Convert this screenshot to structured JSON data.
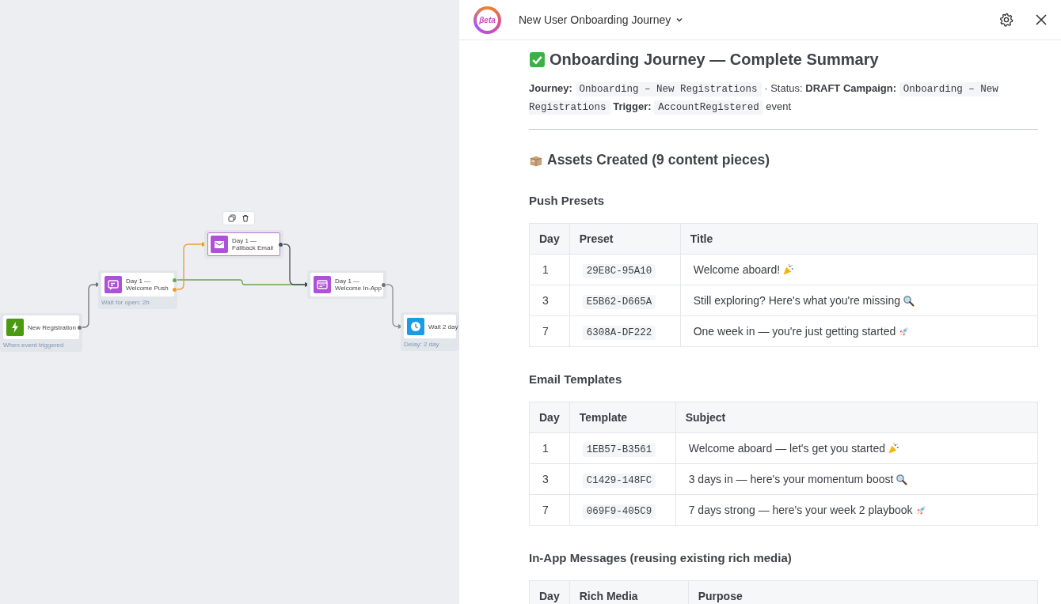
{
  "canvas": {
    "nodes": [
      {
        "kind": "trigger",
        "title": "New Registration",
        "subtitle": "When event triggered",
        "selected": false
      },
      {
        "kind": "push",
        "title": "Day 1 —\nWelcome Push",
        "subtitle": "Wait for open: 2h",
        "selected": false
      },
      {
        "kind": "email",
        "title": "Day 1 —\nFallback Email",
        "selected": true
      },
      {
        "kind": "inapp",
        "title": "Day 1 —\nWelcome In-App",
        "selected": false
      },
      {
        "kind": "delay",
        "title": "Wait 2 day",
        "subtitle": "Delay: 2 day",
        "selected": false
      }
    ]
  },
  "header": {
    "logo_text": "βeta",
    "title": "New User Onboarding Journey"
  },
  "summary": {
    "title": "Onboarding Journey — Complete Summary",
    "meta": [
      {
        "kind": "label",
        "text": "Journey:"
      },
      {
        "kind": "code",
        "text": "Onboarding – New Registrations"
      },
      {
        "kind": "text",
        "text": "· Status:"
      },
      {
        "kind": "label",
        "text": "DRAFT Campaign:"
      },
      {
        "kind": "code",
        "text": "Onboarding – New Registrations"
      },
      {
        "kind": "label",
        "text": "Trigger:"
      },
      {
        "kind": "code",
        "text": "AccountRegistered"
      },
      {
        "kind": "text",
        "text": "event"
      }
    ],
    "assets_title": "Assets Created (9 content pieces)",
    "sections": [
      {
        "title": "Push Presets",
        "columns": [
          "Day",
          "Preset",
          "Title"
        ],
        "rows": [
          {
            "day": "1",
            "id": "29E8C-95A10",
            "text": "Welcome aboard!",
            "kind": "party"
          },
          {
            "day": "3",
            "id": "E5B62-D665A",
            "text": "Still exploring? Here's what you're missing",
            "kind": "search"
          },
          {
            "day": "7",
            "id": "6308A-DF222",
            "text": "One week in — you're just getting started",
            "kind": "rocket"
          }
        ]
      },
      {
        "title": "Email Templates",
        "columns": [
          "Day",
          "Template",
          "Subject"
        ],
        "rows": [
          {
            "day": "1",
            "id": "1EB57-B3561",
            "text": "Welcome aboard — let's get you started",
            "kind": "party"
          },
          {
            "day": "3",
            "id": "C1429-148FC",
            "text": "3 days in — here's your momentum boost",
            "kind": "search"
          },
          {
            "day": "7",
            "id": "069F9-405C9",
            "text": "7 days strong — here's your week 2 playbook",
            "kind": "rocket"
          }
        ]
      },
      {
        "title": "In-App Messages (reusing existing rich media)",
        "columns": [
          "Day",
          "Rich Media",
          "Purpose"
        ]
      }
    ]
  }
}
